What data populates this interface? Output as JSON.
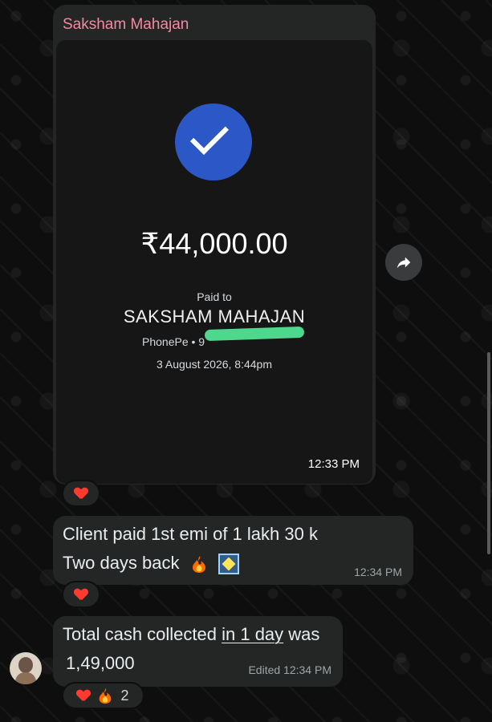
{
  "chat": {
    "message1": {
      "sender": "Saksham Mahajan",
      "receipt": {
        "amount": "₹44,000.00",
        "paid_to_label": "Paid to",
        "payee_name": "SAKSHAM  MAHAJAN",
        "upi_text": "PhonePe • 9",
        "date": "3 August 2026, 8:44pm"
      },
      "time": "12:33 PM",
      "reaction": {
        "emoji": "heart-icon"
      }
    },
    "message2": {
      "line1": "Client paid 1st emi of 1 lakh 30 k",
      "line2": "Two days back",
      "time": "12:34 PM",
      "reaction": {
        "emoji": "heart-icon"
      }
    },
    "message3": {
      "line1_prefix": "Total cash collected ",
      "line1_link": "in 1 day",
      "line1_suffix": " was",
      "line2": "1,49,000",
      "status": "Edited",
      "time": "12:34 PM",
      "reaction": {
        "emojis": [
          "heart-icon",
          "fire-icon"
        ],
        "count": "2"
      }
    }
  },
  "icons": {
    "check": "check-icon",
    "forward": "forward-icon",
    "fire": "fire-icon",
    "sparkle": "sparkle-icon"
  },
  "colors": {
    "background": "#0e0e0e",
    "bubble": "#242626",
    "sender_name": "#f28aa3",
    "check_circle": "#2b57c7",
    "redaction": "#4dd88e"
  }
}
